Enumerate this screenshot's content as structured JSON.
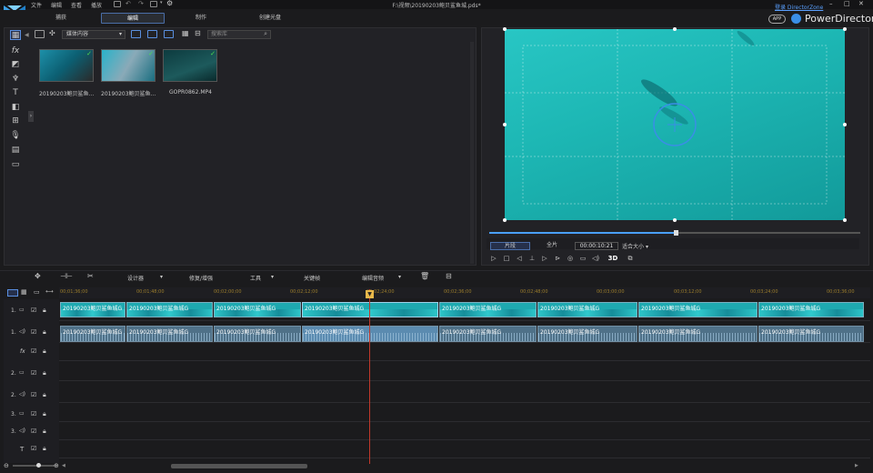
{
  "menu": {
    "file": "文件",
    "edit": "编辑",
    "view": "查看",
    "playback": "播放"
  },
  "window_title": "F:\\视频\\20190203鲍贝鲨鱼城.pds*",
  "tabs": {
    "capture": "捕获",
    "edit": "编辑",
    "produce": "制作",
    "disc": "创建光盘"
  },
  "directorzone": "登录 DirectorZone",
  "app_badge": "APP",
  "brand": "PowerDirector",
  "library": {
    "media_filter": "媒体内容",
    "search_placeholder": "搜索库"
  },
  "media": [
    {
      "label": "20190203鲍贝鲨鱼..."
    },
    {
      "label": "20190203鲍贝鲨鱼..."
    },
    {
      "label": "GOPR0862.MP4"
    }
  ],
  "preview": {
    "clip_tab": "片段",
    "movie_tab": "全片",
    "timecode": "00:00:10:21",
    "fit": "适合大小",
    "scrub_position": 0.5,
    "mode_3d": "3D"
  },
  "edit_toolbar": {
    "designer": "设计器",
    "fix": "修复/增强",
    "tools": "工具",
    "keyframe": "关键帧",
    "edit_audio": "编辑音频"
  },
  "ruler_ticks": [
    "00;01;36;00",
    "00;01;48;00",
    "00;02;00;00",
    "00;02;12;00",
    "00;02;24;00",
    "00;02;36;00",
    "00;02;48;00",
    "00;03;00;00",
    "00;03;12;00",
    "00;03;24;00",
    "00;03;36;00"
  ],
  "tracks": {
    "video1": "1.",
    "audio1": "1.",
    "fx": "fx",
    "video2": "2.",
    "audio2": "2.",
    "video3": "3.",
    "audio3": "3.",
    "title": "T"
  },
  "clip_name": "20190203鲍贝鲨鱼城G"
}
